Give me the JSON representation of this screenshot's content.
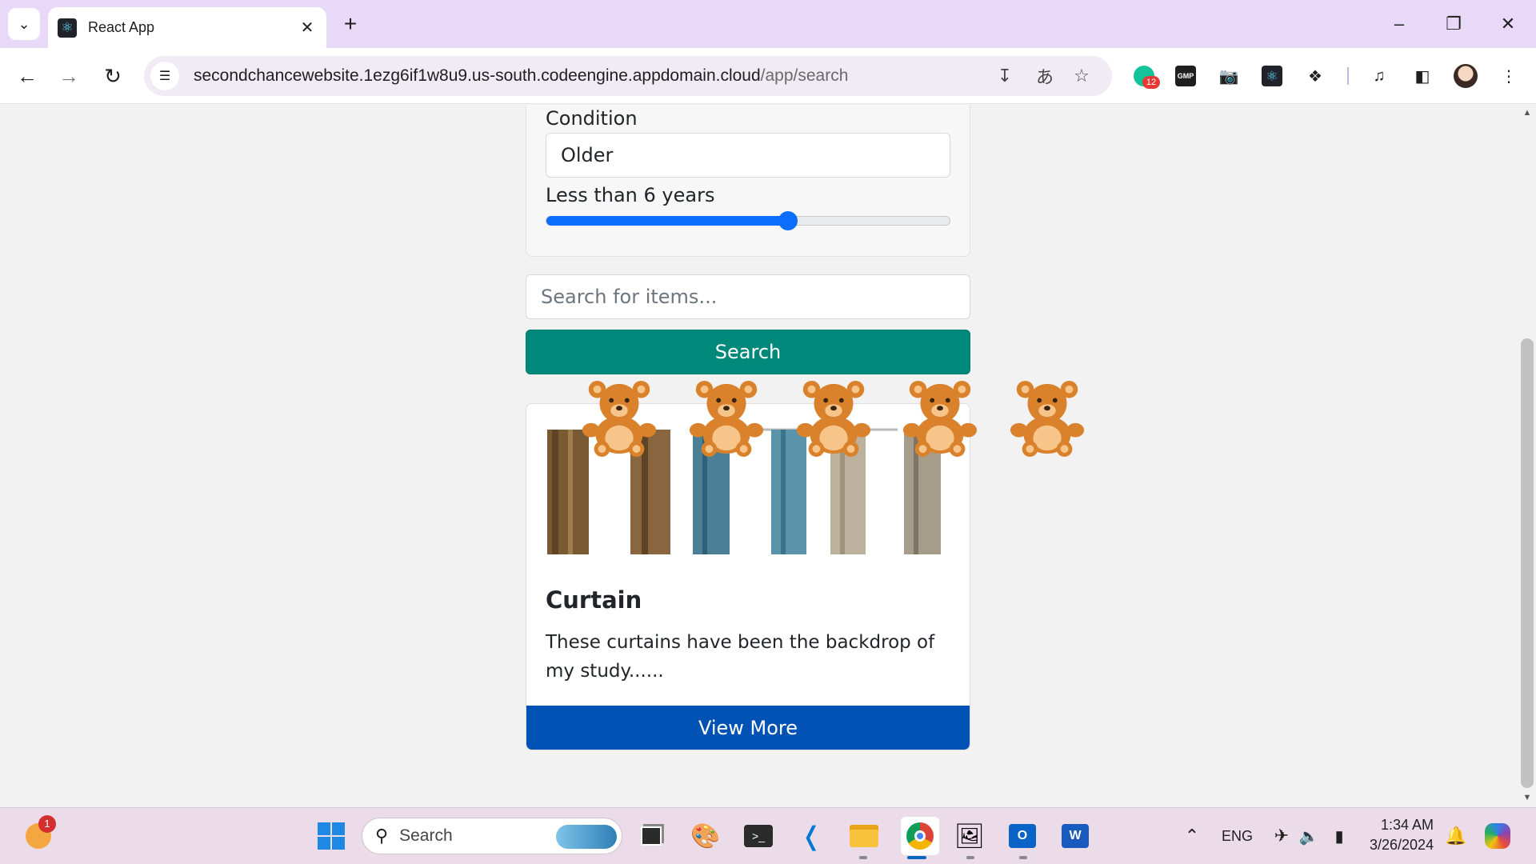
{
  "browser": {
    "tab_title": "React App",
    "url_host": "secondchancewebsite.1ezg6if1w8u9.us-south.codeengine.appdomain.cloud",
    "url_path": "/app/search",
    "extensions": {
      "badge_count": "12",
      "gmp_label": "GMP"
    }
  },
  "filters": {
    "condition_label": "Condition",
    "condition_value": "Older",
    "age_label": "Less than 6 years",
    "age_slider": {
      "min": 0,
      "max": 10,
      "value": 6
    }
  },
  "search": {
    "placeholder": "Search for items...",
    "button_label": "Search"
  },
  "results": [
    {
      "title": "Curtain",
      "description": "These curtains have been the backdrop of my study......",
      "button_label": "View More"
    }
  ],
  "taskbar": {
    "search_label": "Search",
    "notification_count": "1",
    "language": "ENG",
    "time": "1:34 AM",
    "date": "3/26/2024"
  }
}
